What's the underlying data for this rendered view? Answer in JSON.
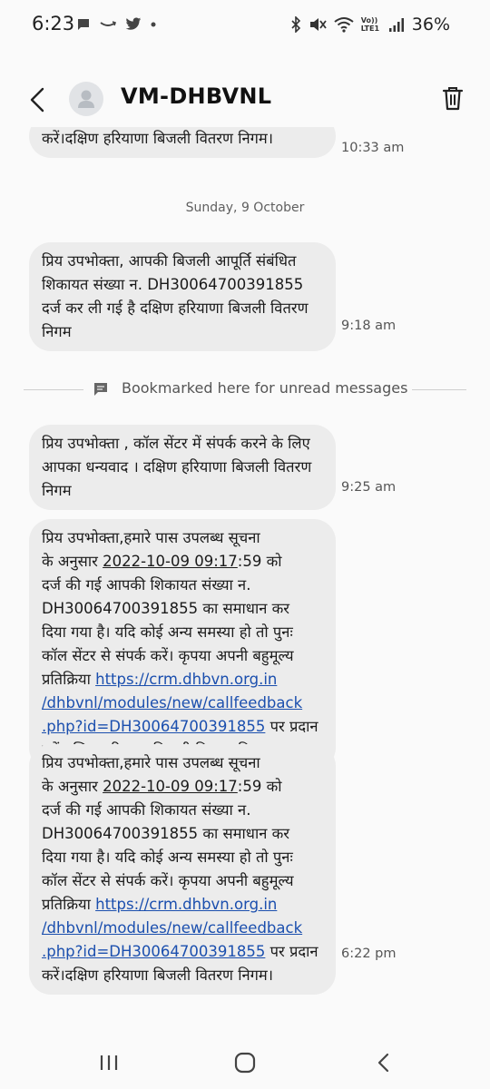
{
  "status_bar": {
    "time": "6:23",
    "left_icons": [
      "chat-bubble-icon",
      "amazon-icon",
      "twitter-icon",
      "dot-icon"
    ],
    "right_icons": [
      "bluetooth-icon",
      "mute-icon",
      "wifi-icon",
      "volte-icon",
      "signal-icon"
    ],
    "volte_label": "Vo)) LTE1",
    "battery": "36%"
  },
  "header": {
    "contact_name": "VM-DHBVNL"
  },
  "messages": [
    {
      "text": "करें।दक्षिण हरियाणा बिजली वितरण निगम।",
      "time": "10:33 am"
    },
    {
      "date_separator": "Sunday, 9 October"
    },
    {
      "text_lines": [
        "प्रिय उपभोक्ता, आपकी बिजली आपूर्ति संबंधित",
        "शिकायत संख्या न. DH30064700391855",
        "दर्ज कर ली गई है दक्षिण हरियाणा बिजली वितरण",
        "निगम"
      ],
      "time": "9:18 am"
    },
    {
      "bookmark_text": "Bookmarked here for unread messages"
    },
    {
      "text_lines": [
        "प्रिय उपभोक्ता , कॉल सेंटर में संपर्क करने के लिए",
        "आपका धन्यवाद । दक्षिण हरियाणा बिजली वितरण",
        "निगम"
      ],
      "time": "9:25 am"
    },
    {
      "line1": "प्रिय उपभोक्ता,हमारे पास उपलब्ध सूचना",
      "line2_pre": "के अनुसार ",
      "datetime": "2022-10-09 09:17",
      "line2_post": ":59 को",
      "line3": "दर्ज की गई आपकी शिकायत संख्या न.",
      "line4": "DH30064700391855 का समाधान कर",
      "line5": "दिया गया है। यदि कोई अन्य समस्या हो तो पुनः",
      "line6": "कॉल सेंटर से संपर्क करें। कृपया अपनी बहुमूल्य",
      "line7_pre": "प्रतिक्रिया ",
      "link1": "https://crm.dhbvn.org.in",
      "link2": "/dhbvnl/modules/new/callfeedback",
      "link3": ".php?id=DH30064700391855",
      "line9_post": " पर प्रदान",
      "line10": "करें।दक्षिण हरियाणा बिजली वितरण निगम।"
    },
    {
      "line1": "प्रिय उपभोक्ता,हमारे पास उपलब्ध सूचना",
      "line2_pre": "के अनुसार ",
      "datetime": "2022-10-09 09:17",
      "line2_post": ":59 को",
      "line3": "दर्ज की गई आपकी शिकायत संख्या न.",
      "line4": "DH30064700391855 का समाधान कर",
      "line5": "दिया गया है। यदि कोई अन्य समस्या हो तो पुनः",
      "line6": "कॉल सेंटर से संपर्क करें। कृपया अपनी बहुमूल्य",
      "line7_pre": "प्रतिक्रिया ",
      "link1": "https://crm.dhbvn.org.in",
      "link2": "/dhbvnl/modules/new/callfeedback",
      "link3": ".php?id=DH30064700391855",
      "line9_post": " पर प्रदान",
      "line10": "करें।दक्षिण हरियाणा बिजली वितरण निगम।",
      "time": "6:22 pm"
    }
  ],
  "nav_bar": {
    "buttons": [
      "recent-apps-icon",
      "home-icon",
      "back-icon"
    ]
  },
  "colors": {
    "background": "#fafafa",
    "bubble": "#ececec",
    "link": "#1b4fae"
  }
}
